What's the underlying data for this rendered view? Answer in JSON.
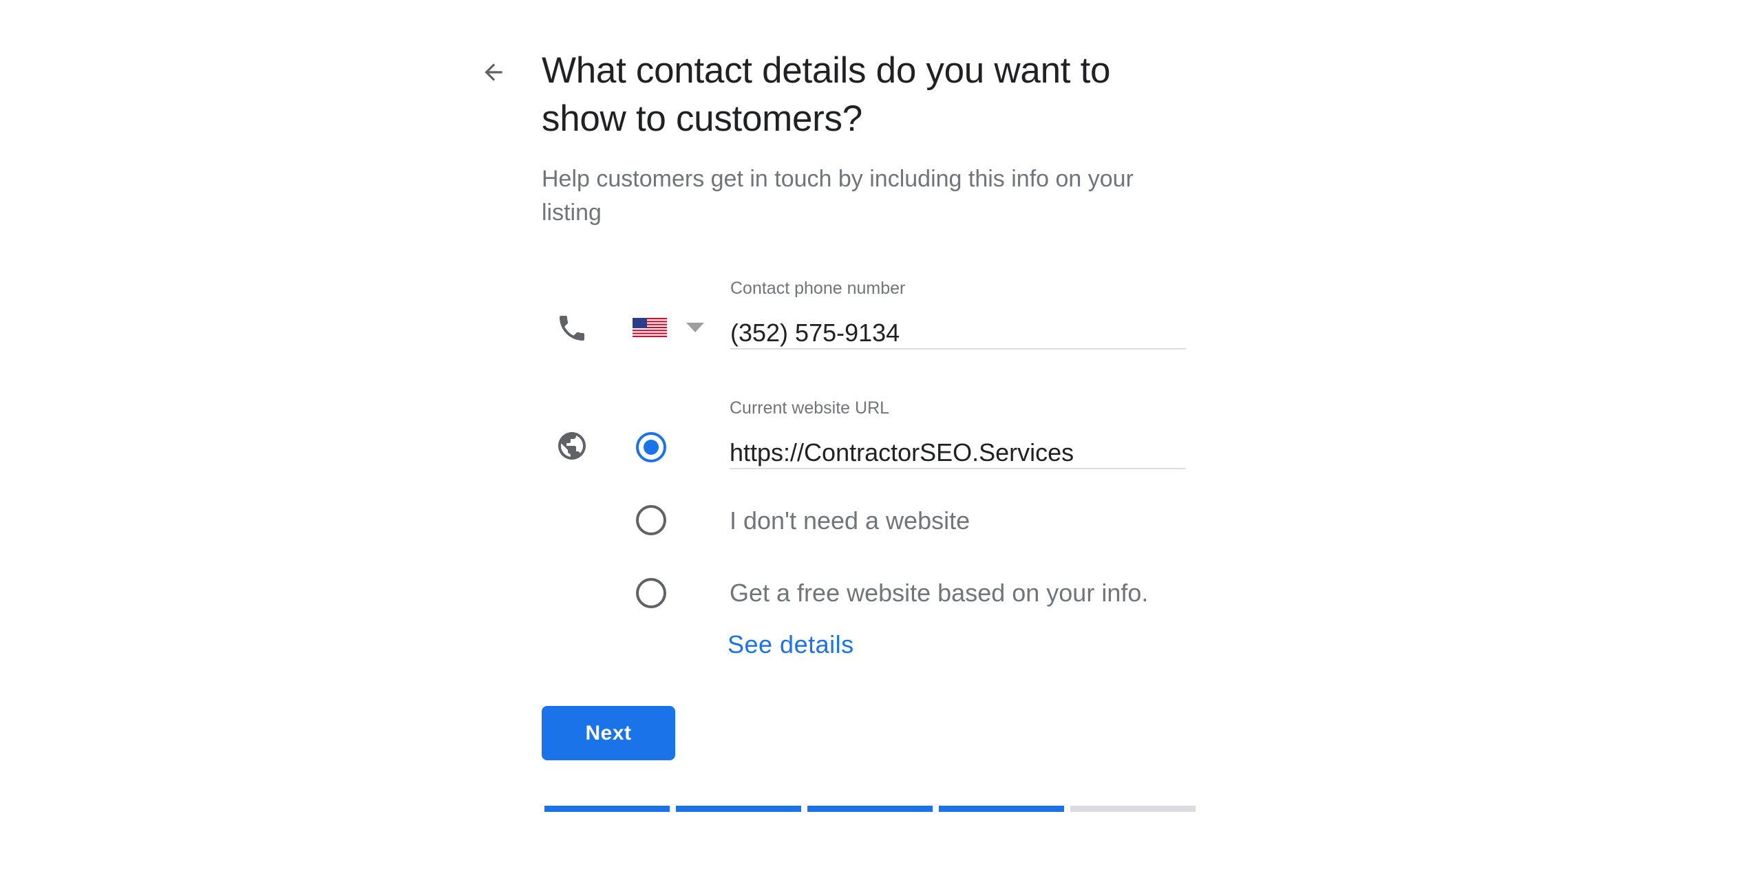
{
  "header": {
    "back_icon": "arrow-back-icon",
    "title": "What contact details do you want to show to customers?",
    "subtitle": "Help customers get in touch by including this info on your listing"
  },
  "phone": {
    "icon": "phone-icon",
    "country_flag": "US",
    "country_dropdown_icon": "arrow-drop-down-icon",
    "label": "Contact phone number",
    "value": "(352) 575-9134"
  },
  "website": {
    "icon": "globe-icon",
    "label": "Current website URL",
    "value": "https://ContractorSEO.Services",
    "options": [
      {
        "label": "Current website URL",
        "selected": true
      },
      {
        "label": "I don't need a website",
        "selected": false
      },
      {
        "label": "Get a free website based on your info.",
        "selected": false
      }
    ],
    "see_details_link": "See details"
  },
  "actions": {
    "next_label": "Next"
  },
  "progress": {
    "total_steps": 5,
    "completed_steps": 4,
    "accent_color": "#1a73e8",
    "inactive_color": "#dadce0"
  }
}
